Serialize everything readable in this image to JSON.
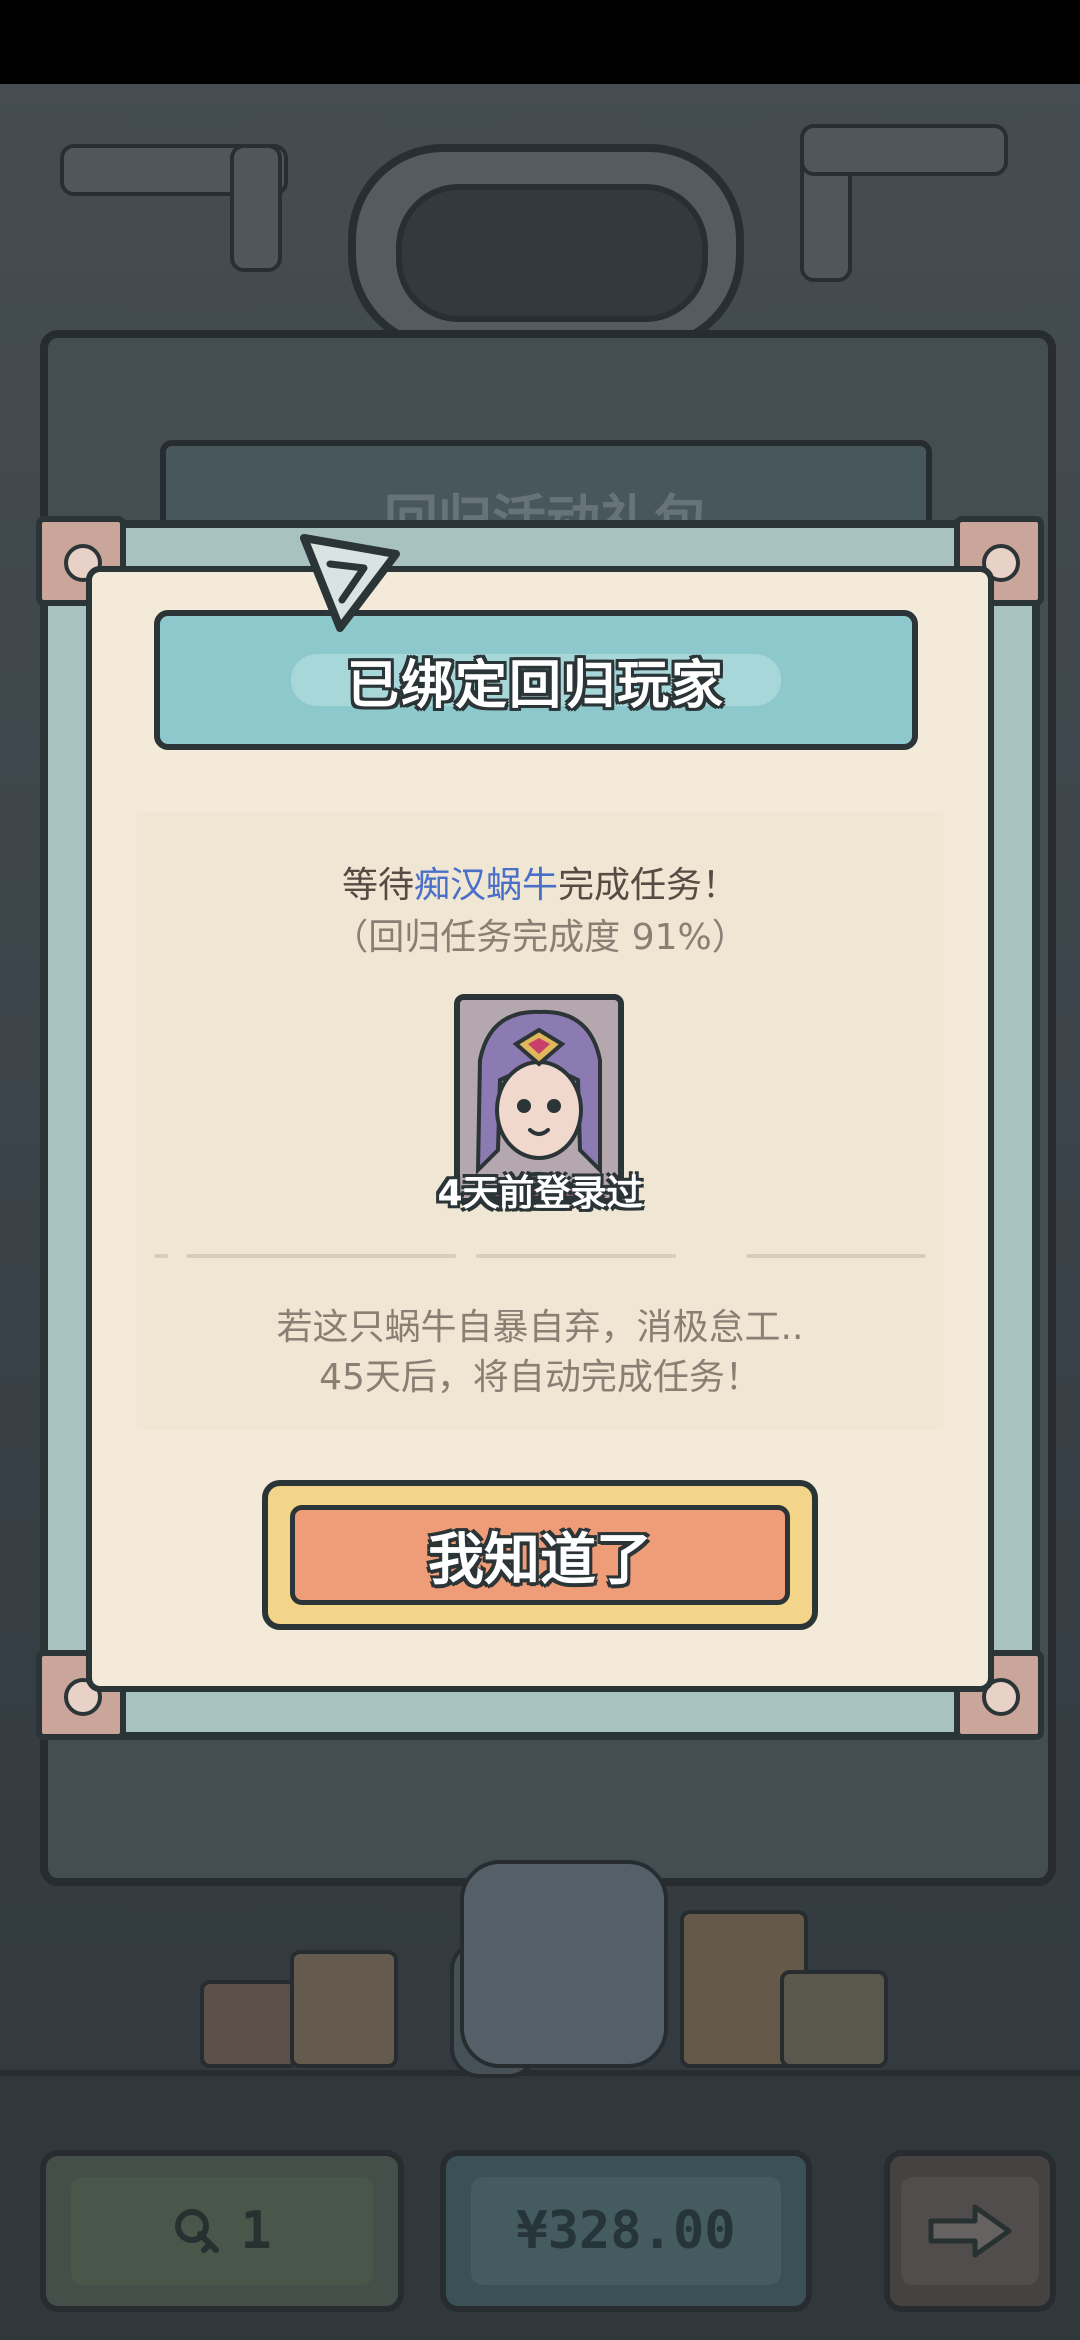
{
  "background": {
    "banner_title": "回归活动礼包",
    "key_count": "1",
    "price": "¥328.00"
  },
  "dialog": {
    "title": "已绑定回归玩家",
    "wait_prefix": "等待",
    "player_name": "痴汉蜗牛",
    "wait_suffix": "完成任务！",
    "progress_text": "（回归任务完成度 91%）",
    "last_login": "4天前登录过",
    "note_line1": "若这只蜗牛自暴自弃，消极怠工..",
    "note_line2": "45天后，将自动完成任务！",
    "ack_button": "我知道了"
  },
  "colors": {
    "accent_name": "#4a6fc9",
    "title_bar": "#8dc9cc",
    "button": "#ef9d78"
  },
  "icons": {
    "key": "key-icon",
    "next": "arrow-right-icon",
    "badge": "triangle-badge-icon"
  }
}
